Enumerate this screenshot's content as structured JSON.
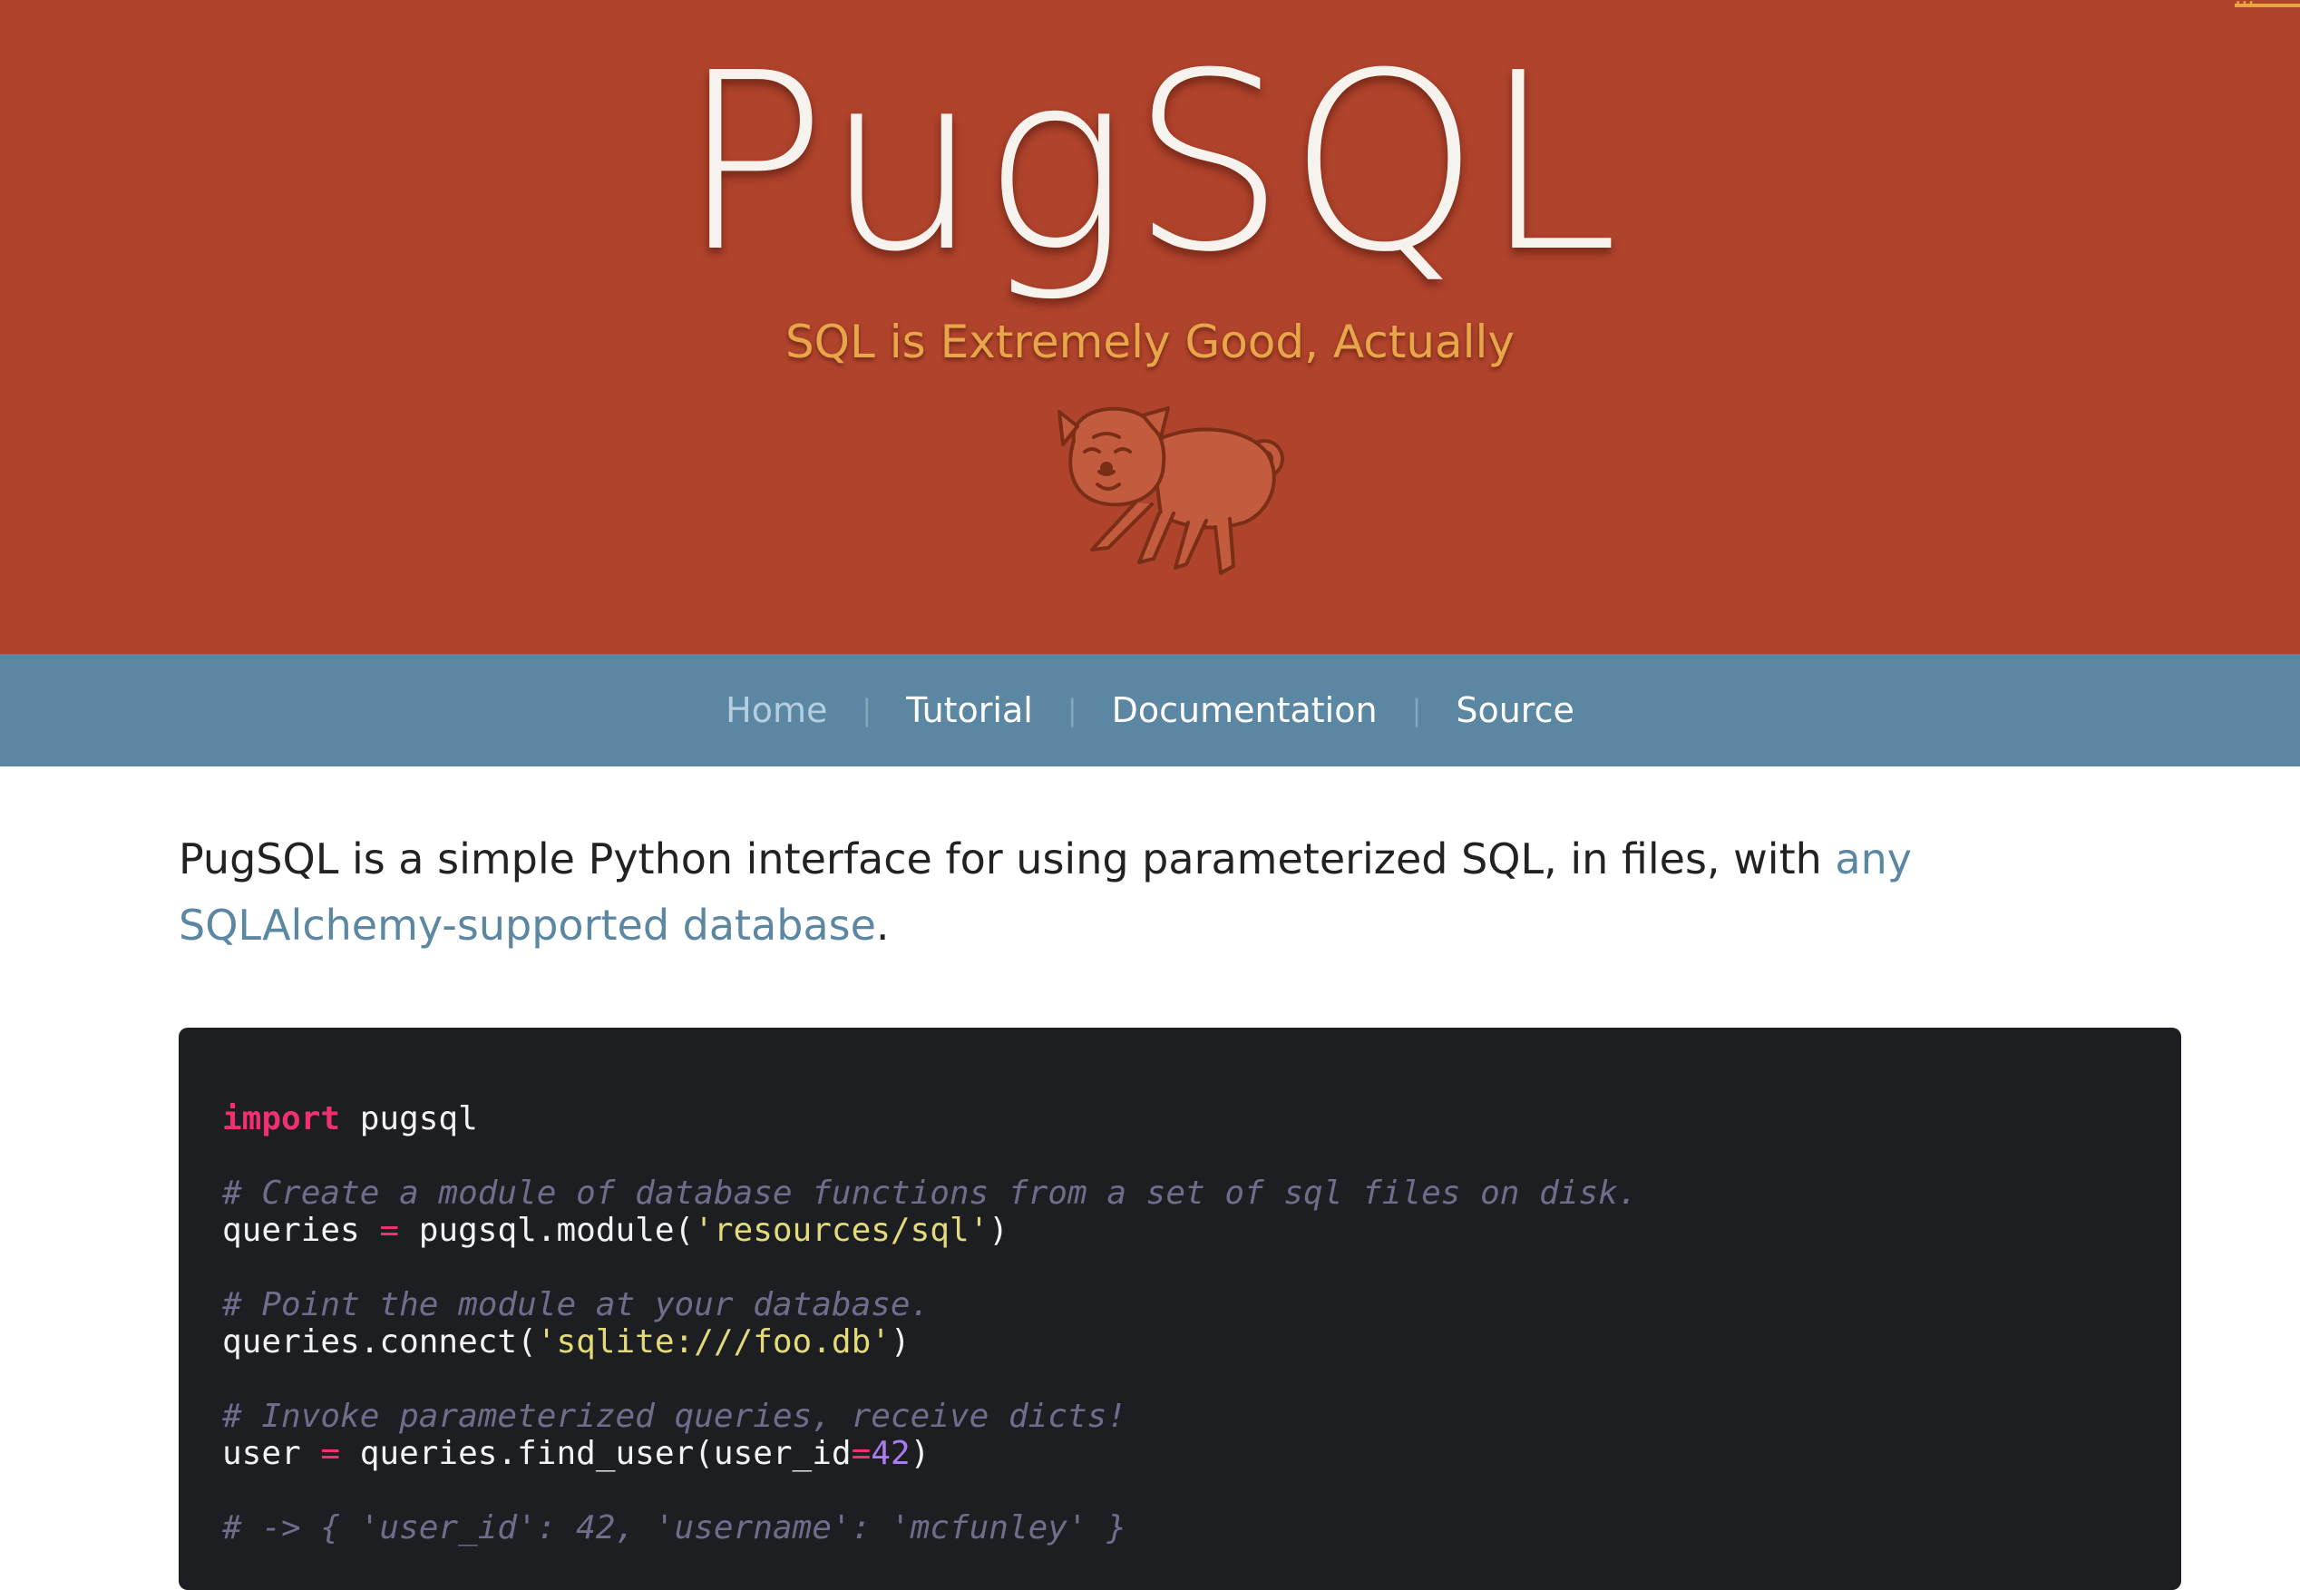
{
  "header": {
    "corner_link": "...",
    "title": "PugSQL",
    "tagline": "SQL is Extremely Good, Actually",
    "logo_icon": "pug-dog-icon"
  },
  "nav": {
    "items": [
      {
        "label": "Home",
        "active": true
      },
      {
        "label": "Tutorial"
      },
      {
        "label": "Documentation"
      },
      {
        "label": "Source"
      }
    ],
    "separator": "|"
  },
  "intro": {
    "text": "PugSQL is a simple Python interface for using parameterized SQL, in files, with ",
    "link_text": "any SQLAlchemy-supported database",
    "suffix": "."
  },
  "code": {
    "line1": {
      "keyword": "import",
      "rest": " pugsql"
    },
    "comment1": "# Create a module of database functions from a set of sql files on disk.",
    "line2": {
      "pre": "queries ",
      "op": "=",
      "mid": " pugsql.module(",
      "str": "'resources/sql'",
      "post": ")"
    },
    "comment2": "# Point the module at your database.",
    "line3": {
      "pre": "queries.connect(",
      "str": "'sqlite:///foo.db'",
      "post": ")"
    },
    "comment3": "# Invoke parameterized queries, receive dicts!",
    "line4": {
      "pre": "user ",
      "op": "=",
      "mid": " queries.find_user(user_id",
      "op2": "=",
      "num": "42",
      "post": ")"
    },
    "comment4": "# -> { 'user_id': 42, 'username': 'mcfunley' }"
  },
  "colors": {
    "hero_bg": "#b0432c",
    "nav_bg": "#5b87a2",
    "tagline": "#e8a64a",
    "link": "#5b87a2",
    "code_bg": "#1d1e22"
  }
}
